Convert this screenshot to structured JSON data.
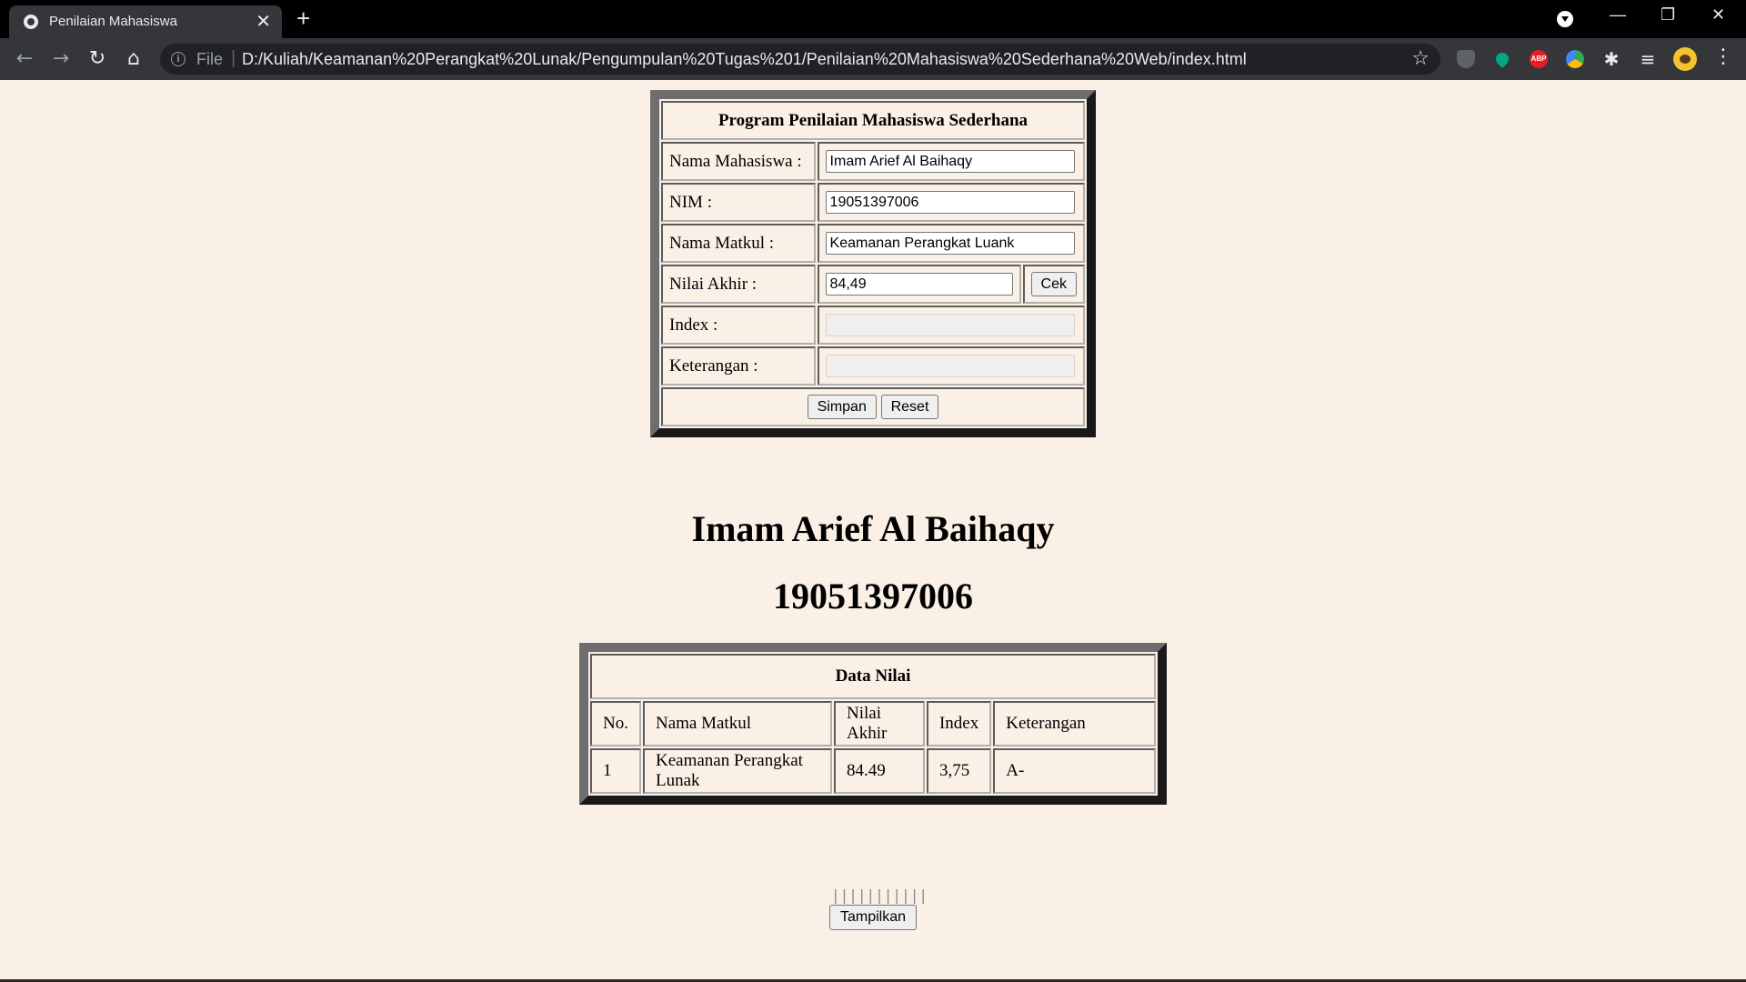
{
  "browser": {
    "tab_title": "Penilaian Mahasiswa",
    "tab_close": "✕",
    "new_tab": "+",
    "file_label": "File",
    "url": "D:/Kuliah/Keamanan%20Perangkat%20Lunak/Pengumpulan%20Tugas%201/Penilaian%20Mahasiswa%20Sederhana%20Web/index.html",
    "extensions": [
      "shield-icon",
      "map-marker-icon",
      "adblock-plus-icon",
      "color-circle-icon",
      "puzzle-icon",
      "playlist-icon"
    ],
    "abp_label": "ABP"
  },
  "form": {
    "title": "Program Penilaian Mahasiswa Sederhana",
    "nama_label": "Nama Mahasiswa :",
    "nama_value": "Imam Arief Al Baihaqy",
    "nim_label": "NIM :",
    "nim_value": "19051397006",
    "matkul_label": "Nama Matkul :",
    "matkul_value": "Keamanan Perangkat Luank",
    "nilai_label": "Nilai Akhir :",
    "nilai_value": "84,49",
    "cek_label": "Cek",
    "index_label": "Index :",
    "index_value": "",
    "ket_label": "Keterangan :",
    "ket_value": "",
    "simpan_label": "Simpan",
    "reset_label": "Reset"
  },
  "student": {
    "name": "Imam Arief Al Baihaqy",
    "nim": "19051397006"
  },
  "data_table": {
    "caption": "Data Nilai",
    "headers": [
      "No.",
      "Nama Matkul",
      "Nilai Akhir",
      "Index",
      "Keterangan"
    ],
    "rows": [
      [
        "1",
        "Keamanan Perangkat Lunak",
        "84.49",
        "3,75",
        "A-"
      ]
    ]
  },
  "pipes": "|||||||||||",
  "tampilkan_label": "Tampilkan"
}
